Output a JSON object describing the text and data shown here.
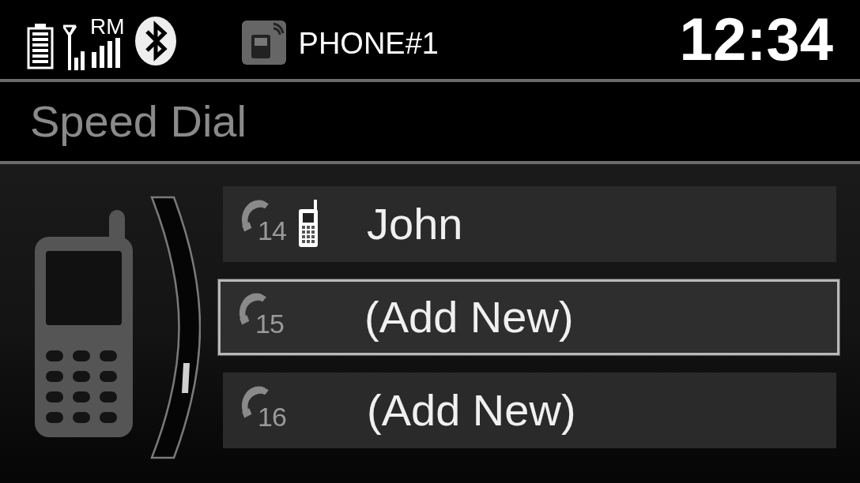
{
  "status_bar": {
    "roaming": "RM",
    "phone_name": "PHONE#1",
    "time": "12:34"
  },
  "title": "Speed Dial",
  "entries": [
    {
      "number": "14",
      "kind": "contact",
      "label": "John",
      "selected": false
    },
    {
      "number": "15",
      "kind": "empty",
      "label": "(Add New)",
      "selected": true
    },
    {
      "number": "16",
      "kind": "empty",
      "label": "(Add New)",
      "selected": false
    }
  ]
}
